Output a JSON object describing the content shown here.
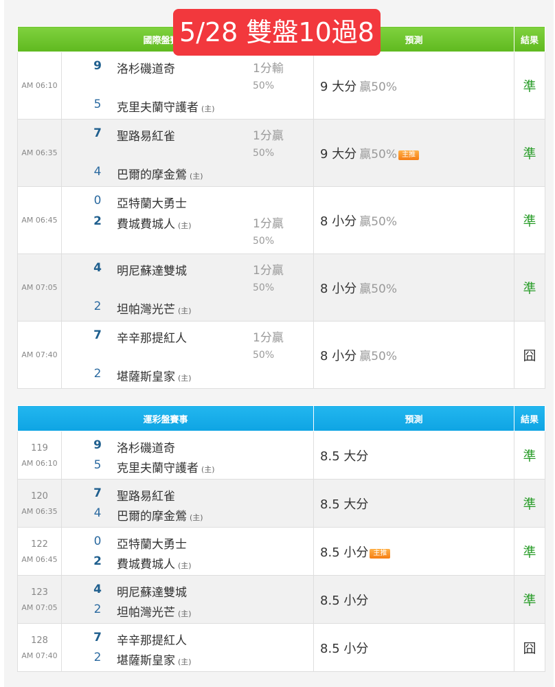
{
  "overlay_title": "5/28 雙盤10過8",
  "intl": {
    "header": {
      "col_event": "國際盤賽事",
      "col_pred": "預測",
      "col_result": "結果"
    },
    "rows": [
      {
        "time": "AM 06:10",
        "away": {
          "score": "9",
          "name": "洛杉磯道奇"
        },
        "home": {
          "score": "5",
          "name": "克里夫蘭守護者"
        },
        "home_mark": "(主)",
        "odds_line": "1分輸",
        "odds_pct": "50%",
        "pred_value": "9 大分",
        "pred_win": "贏50%",
        "badge": "",
        "result": "準"
      },
      {
        "time": "AM 06:35",
        "away": {
          "score": "7",
          "name": "聖路易紅雀"
        },
        "home": {
          "score": "4",
          "name": "巴爾的摩金鶯"
        },
        "home_mark": "(主)",
        "odds_line": "1分贏",
        "odds_pct": "50%",
        "pred_value": "9 大分",
        "pred_win": "贏50%",
        "badge": "主推",
        "result": "準"
      },
      {
        "time": "AM 06:45",
        "away": {
          "score": "0",
          "name": "亞特蘭大勇士"
        },
        "home": {
          "score": "2",
          "name": "費城費城人"
        },
        "home_mark": "(主)",
        "odds_line": "1分贏",
        "odds_pct": "50%",
        "pred_value": "8 小分",
        "pred_win": "贏50%",
        "badge": "",
        "result": "準"
      },
      {
        "time": "AM 07:05",
        "away": {
          "score": "4",
          "name": "明尼蘇達雙城"
        },
        "home": {
          "score": "2",
          "name": "坦帕灣光芒"
        },
        "home_mark": "(主)",
        "odds_line": "1分贏",
        "odds_pct": "50%",
        "pred_value": "8 小分",
        "pred_win": "贏50%",
        "badge": "",
        "result": "準"
      },
      {
        "time": "AM 07:40",
        "away": {
          "score": "7",
          "name": "辛辛那提紅人"
        },
        "home": {
          "score": "2",
          "name": "堪薩斯皇家"
        },
        "home_mark": "(主)",
        "odds_line": "1分贏",
        "odds_pct": "50%",
        "pred_value": "8 小分",
        "pred_win": "贏50%",
        "badge": "",
        "result": "囧"
      }
    ]
  },
  "sport": {
    "header": {
      "col_event": "運彩盤賽事",
      "col_pred": "預測",
      "col_result": "結果"
    },
    "rows": [
      {
        "num": "119",
        "time": "AM 06:10",
        "away": {
          "score": "9",
          "name": "洛杉磯道奇"
        },
        "home": {
          "score": "5",
          "name": "克里夫蘭守護者"
        },
        "home_mark": "(主)",
        "pred_value": "8.5 大分",
        "badge": "",
        "result": "準"
      },
      {
        "num": "120",
        "time": "AM 06:35",
        "away": {
          "score": "7",
          "name": "聖路易紅雀"
        },
        "home": {
          "score": "4",
          "name": "巴爾的摩金鶯"
        },
        "home_mark": "(主)",
        "pred_value": "8.5 大分",
        "badge": "",
        "result": "準"
      },
      {
        "num": "122",
        "time": "AM 06:45",
        "away": {
          "score": "0",
          "name": "亞特蘭大勇士"
        },
        "home": {
          "score": "2",
          "name": "費城費城人"
        },
        "home_mark": "(主)",
        "pred_value": "8.5 小分",
        "badge": "主推",
        "result": "準"
      },
      {
        "num": "123",
        "time": "AM 07:05",
        "away": {
          "score": "4",
          "name": "明尼蘇達雙城"
        },
        "home": {
          "score": "2",
          "name": "坦帕灣光芒"
        },
        "home_mark": "(主)",
        "pred_value": "8.5 小分",
        "badge": "",
        "result": "準"
      },
      {
        "num": "128",
        "time": "AM 07:40",
        "away": {
          "score": "7",
          "name": "辛辛那提紅人"
        },
        "home": {
          "score": "2",
          "name": "堪薩斯皇家"
        },
        "home_mark": "(主)",
        "pred_value": "8.5 小分",
        "badge": "",
        "result": "囧"
      }
    ]
  },
  "colors": {
    "intl_header": "#6cc52a",
    "sport_header": "#17aceb",
    "ok": "#2a9d2a",
    "overlay": "#f2383d",
    "badge": "#f8942c"
  }
}
